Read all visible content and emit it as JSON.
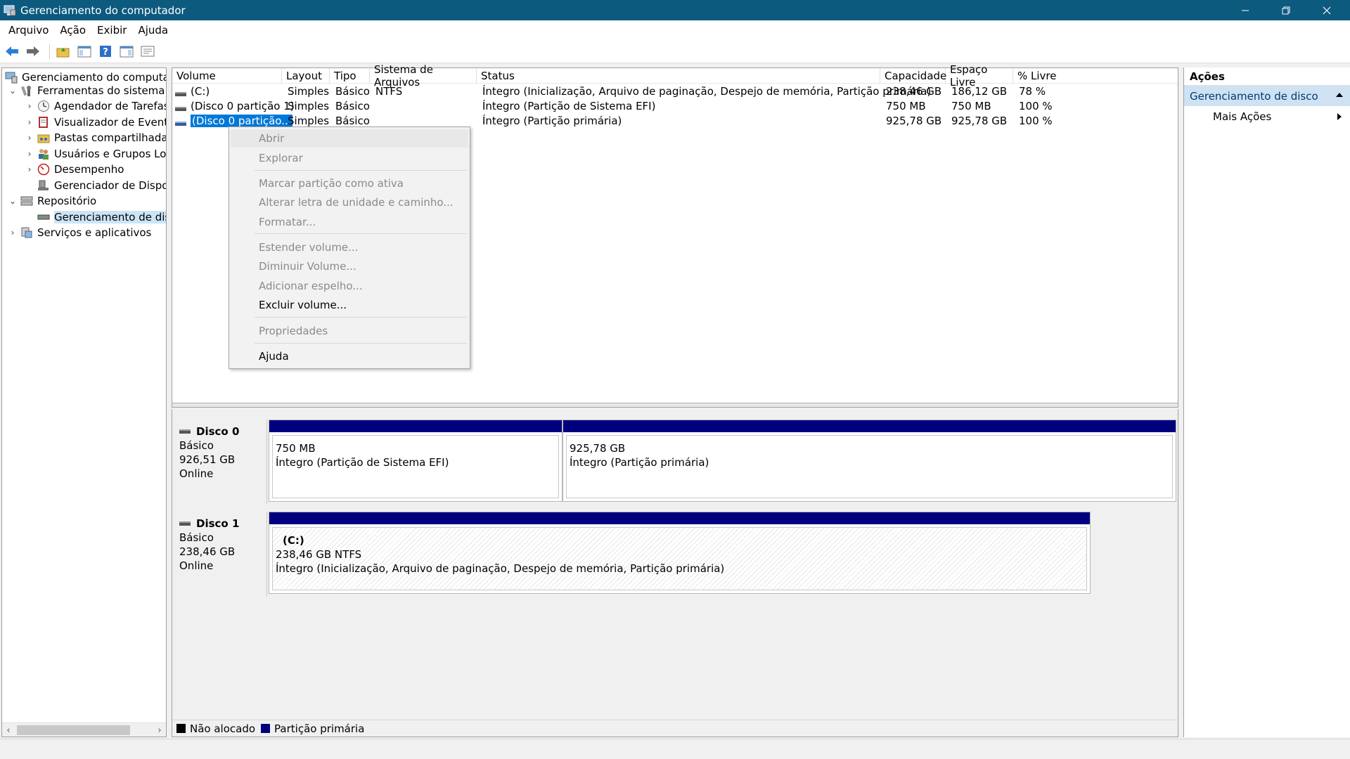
{
  "window": {
    "title": "Gerenciamento do computador"
  },
  "menu": [
    "Arquivo",
    "Ação",
    "Exibir",
    "Ajuda"
  ],
  "tree": {
    "items": [
      {
        "label": "Gerenciamento do computador",
        "icon": "computer-management-icon",
        "expander": ""
      },
      {
        "label": "Ferramentas do sistema",
        "icon": "system-tools-icon",
        "expander": "expanded"
      },
      {
        "label": "Agendador de Tarefas",
        "icon": "task-scheduler-icon",
        "expander": "collapsed"
      },
      {
        "label": "Visualizador de Eventos",
        "icon": "event-viewer-icon",
        "expander": "collapsed"
      },
      {
        "label": "Pastas compartilhadas",
        "icon": "shared-folders-icon",
        "expander": "collapsed"
      },
      {
        "label": "Usuários e Grupos Locai",
        "icon": "users-groups-icon",
        "expander": "collapsed"
      },
      {
        "label": "Desempenho",
        "icon": "performance-icon",
        "expander": "collapsed"
      },
      {
        "label": "Gerenciador de Disposit",
        "icon": "device-manager-icon",
        "expander": ""
      },
      {
        "label": "Repositório",
        "icon": "storage-icon",
        "expander": "expanded"
      },
      {
        "label": "Gerenciamento de disco",
        "icon": "disk-management-icon",
        "expander": ""
      },
      {
        "label": "Serviços e aplicativos",
        "icon": "services-apps-icon",
        "expander": "collapsed"
      }
    ]
  },
  "volume_list": {
    "columns": [
      "Volume",
      "Layout",
      "Tipo",
      "Sistema de Arquivos",
      "Status",
      "Capacidade",
      "Espaço Livre",
      "% Livre"
    ],
    "rows": [
      {
        "volume": "(C:)",
        "layout": "Simples",
        "tipo": "Básico",
        "fs": "NTFS",
        "status": "Íntegro (Inicialização, Arquivo de paginação, Despejo de memória, Partição primária)",
        "capacidade": "238,46 GB",
        "livre": "186,12 GB",
        "pct": "78 %"
      },
      {
        "volume": "(Disco 0 partição 1)",
        "layout": "Simples",
        "tipo": "Básico",
        "fs": "",
        "status": "Íntegro (Partição de Sistema EFI)",
        "capacidade": "750 MB",
        "livre": "750 MB",
        "pct": "100 %"
      },
      {
        "volume": "(Disco 0 partição...",
        "layout": "Simples",
        "tipo": "Básico",
        "fs": "",
        "status": "Íntegro (Partição primária)",
        "capacidade": "925,78 GB",
        "livre": "925,78 GB",
        "pct": "100 %"
      }
    ]
  },
  "context_menu": {
    "items": [
      {
        "label": "Abrir",
        "enabled": false
      },
      {
        "label": "Explorar",
        "enabled": false
      },
      {
        "label": "Marcar partição como ativa",
        "enabled": false
      },
      {
        "label": "Alterar letra de unidade e caminho...",
        "enabled": false
      },
      {
        "label": "Formatar...",
        "enabled": false
      },
      {
        "label": "Estender volume...",
        "enabled": false
      },
      {
        "label": "Diminuir Volume...",
        "enabled": false
      },
      {
        "label": "Adicionar espelho...",
        "enabled": false
      },
      {
        "label": "Excluir volume...",
        "enabled": true
      },
      {
        "label": "Propriedades",
        "enabled": false
      },
      {
        "label": "Ajuda",
        "enabled": true
      }
    ]
  },
  "disks": [
    {
      "name": "Disco 0",
      "type": "Básico",
      "size": "926,51 GB",
      "state": "Online",
      "partitions": [
        {
          "title": "",
          "line1": "750 MB",
          "line2": "Íntegro (Partição de Sistema EFI)"
        },
        {
          "title": "",
          "line1": "925,78 GB",
          "line2": "Íntegro (Partição primária)"
        }
      ]
    },
    {
      "name": "Disco 1",
      "type": "Básico",
      "size": "238,46 GB",
      "state": "Online",
      "partitions": [
        {
          "title": "(C:)",
          "line1": "238,46 GB NTFS",
          "line2": "Íntegro (Inicialização, Arquivo de paginação, Despejo de memória, Partição primária)"
        }
      ]
    }
  ],
  "legend": [
    {
      "label": "Não alocado",
      "color": "#000000"
    },
    {
      "label": "Partição primária",
      "color": "#00007f"
    }
  ],
  "actions": {
    "header": "Ações",
    "section": "Gerenciamento de disco",
    "items": [
      "Mais Ações"
    ]
  },
  "colors": {
    "titlebar": "#0d5a7f",
    "selection": "#0078d7",
    "partition_bar": "#00007f",
    "actions_section": "#cfe2f3"
  }
}
